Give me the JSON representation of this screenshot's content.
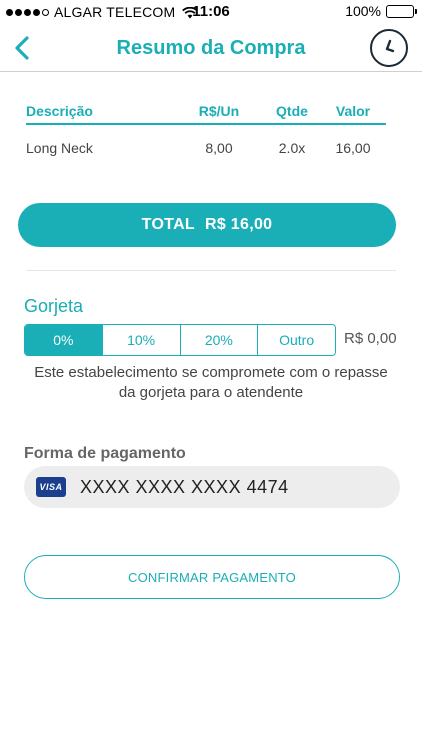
{
  "status_bar": {
    "carrier": "ALGAR TELECOM",
    "time": "11:06",
    "battery": "100%",
    "signal_bars": 4,
    "signal_max": 5
  },
  "nav": {
    "title": "Resumo da Compra",
    "back_icon": "chevron-left-icon",
    "history_icon": "clock-icon"
  },
  "table": {
    "headers": {
      "description": "Descrição",
      "unit_price": "R$/Un",
      "quantity": "Qtde",
      "value": "Valor"
    },
    "rows": [
      {
        "description": "Long Neck",
        "unit_price": "8,00",
        "quantity": "2.0x",
        "value": "16,00"
      }
    ]
  },
  "total": {
    "label": "TOTAL",
    "amount": "R$ 16,00"
  },
  "tip": {
    "title": "Gorjeta",
    "options": [
      "0%",
      "10%",
      "20%",
      "Outro"
    ],
    "selected_index": 0,
    "amount": "R$ 0,00",
    "note": "Este estabelecimento se compromete com o repasse da gorjeta para o atendente"
  },
  "payment": {
    "title": "Forma de pagamento",
    "card_brand": "VISA",
    "card_number": "XXXX XXXX XXXX 4474"
  },
  "confirm": {
    "label": "CONFIRMAR PAGAMENTO"
  },
  "colors": {
    "accent": "#1aaeb7",
    "dark": "#1b2a33",
    "field_bg": "#ededed",
    "visa": "#1a3f8f"
  }
}
